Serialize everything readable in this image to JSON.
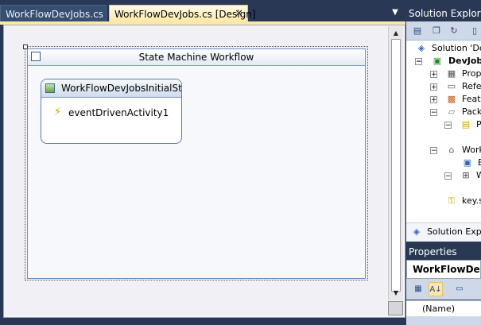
{
  "tabs": [
    {
      "label": "WorkFlowDevJobs.cs",
      "active": false
    },
    {
      "label": "WorkFlowDevJobs.cs [Design]",
      "active": true
    }
  ],
  "designer": {
    "workflow_title": "State Machine Workflow",
    "state_title": "WorkFlowDevJobsInitialState",
    "activity_label": "eventDrivenActivity1"
  },
  "solution_explorer": {
    "title": "Solution Explorer",
    "items": [
      {
        "label": "Solution 'Dev",
        "expander": "",
        "icon": "solution-icon"
      },
      {
        "label": "DevJobs",
        "expander": "-",
        "icon": "project-icon",
        "bold": true
      },
      {
        "label": "Propert",
        "expander": "+",
        "icon": "properties-folder-icon"
      },
      {
        "label": "Refere",
        "expander": "+",
        "icon": "references-icon"
      },
      {
        "label": "Featur",
        "expander": "+",
        "icon": "features-icon"
      },
      {
        "label": "Packag",
        "expander": "-",
        "icon": "package-folder-icon"
      },
      {
        "label": "P",
        "expander": "-",
        "icon": "package-icon"
      },
      {
        "label": "Work",
        "expander": "-",
        "icon": "workflow-folder-icon"
      },
      {
        "label": "E",
        "expander": "",
        "icon": "elements-icon"
      },
      {
        "label": "W",
        "expander": "-",
        "icon": "workflow-file-icon"
      },
      {
        "label": "key.s",
        "expander": "",
        "icon": "key-icon"
      }
    ],
    "footer": "Solution Explor"
  },
  "properties": {
    "title": "Properties",
    "object": "WorkFlowDevJo",
    "row_label": "(Name)"
  }
}
